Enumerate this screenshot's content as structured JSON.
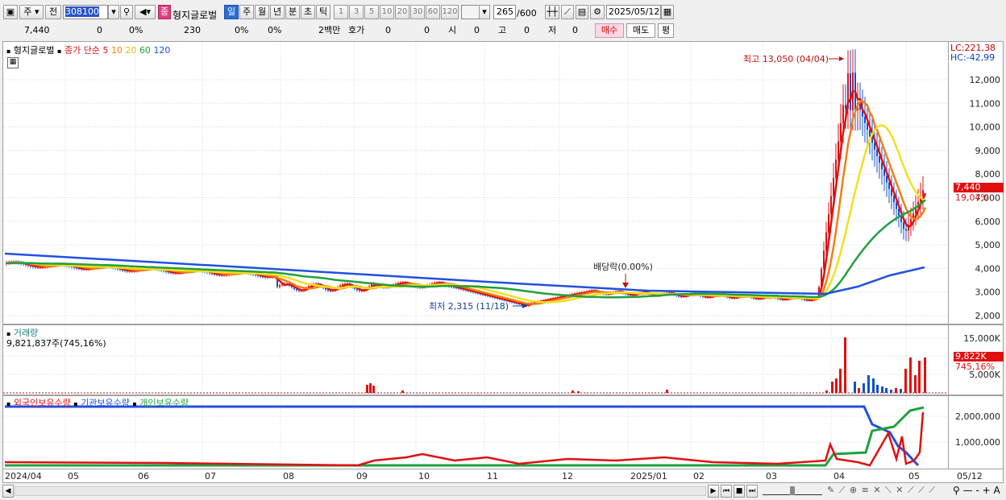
{
  "toolbar": {
    "market": "주",
    "prev": "전",
    "code": "308100",
    "tag": "종",
    "name": "형지글로벌",
    "periods": [
      "일",
      "주",
      "월",
      "년",
      "분",
      "초",
      "틱"
    ],
    "active_period": "일",
    "intervals": [
      "1",
      "3",
      "5",
      "10",
      "20",
      "30",
      "60",
      "120"
    ],
    "count": "265",
    "count_total": "/600",
    "date": "2025/05/12"
  },
  "quote": {
    "price": "7,440",
    "diff": "0",
    "rate": "0%",
    "volume": "230",
    "vol_rate1": "0%",
    "vol_rate2": "0%",
    "unit": "2백만",
    "hoga_label": "호가",
    "hoga_v1": "0",
    "hoga_v2": "0",
    "open_label": "시",
    "open_val": "0",
    "high_label": "고",
    "high_val": "0",
    "low_label": "저",
    "low_val": "0",
    "buy": "매수",
    "sell": "매도",
    "eval": "평"
  },
  "price_panel": {
    "legend_name": "형지글로벌",
    "legend_type": "종가 단순",
    "ma_labels": [
      "5",
      "10",
      "20",
      "60",
      "120"
    ],
    "high_annot": "최고 13,050 (04/04)",
    "low_annot": "최저 2,315 (11/18)",
    "dividend_annot": "배당락(0.00%)",
    "lc": "LC:221,38",
    "hc": "HC:-42,99",
    "last_price": "7,440",
    "last_rate": "19,04%",
    "y_ticks": [
      "12,000",
      "11,000",
      "10,000",
      "9,000",
      "8,000",
      "7,000",
      "6,000",
      "5,000",
      "4,000",
      "3,000",
      "2,000"
    ]
  },
  "volume_panel": {
    "title": "거래량",
    "value": "9,821,837주(745,16%)",
    "y_ticks": [
      "15,000K",
      "10,000K",
      "5,000K"
    ],
    "last_value": "9,822K",
    "last_rate": "745,16%"
  },
  "holding_panel": {
    "labels": [
      "외국인보유수량",
      "기관보유수량",
      "개인보유수량"
    ],
    "y_ticks": [
      "2,000,000",
      "1,000,000"
    ]
  },
  "x_labels": [
    "2024/04",
    "05",
    "06",
    "07",
    "08",
    "09",
    "10",
    "11",
    "12",
    "2025/01",
    "02",
    "03",
    "04",
    "05",
    "05/12"
  ],
  "colors": {
    "ma5": "#e01010",
    "ma10": "#f08010",
    "ma20": "#f0e020",
    "ma60": "#20a040",
    "ma120": "#2050e0",
    "up": "#e01010",
    "down": "#1050d0"
  }
}
